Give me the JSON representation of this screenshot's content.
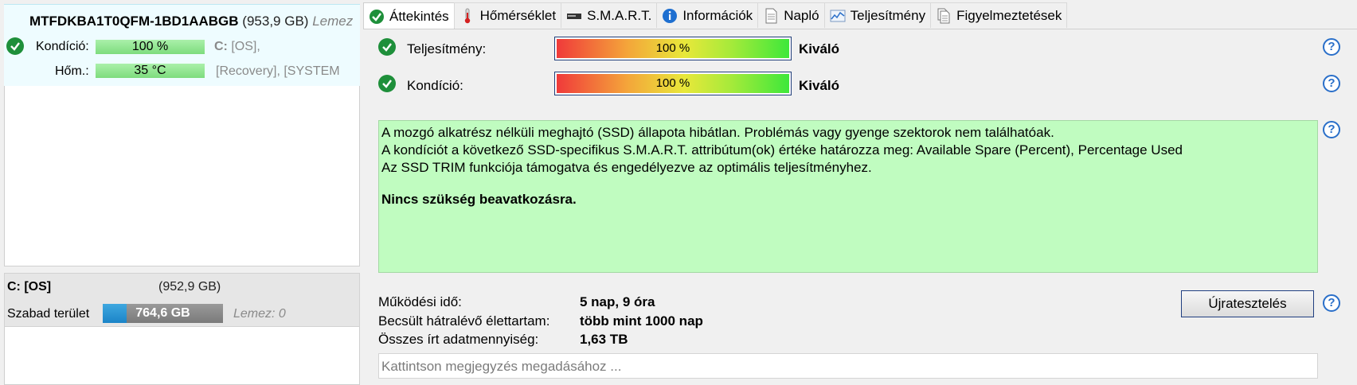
{
  "disk": {
    "model": "MTFDKBA1T0QFM-1BD1AABGB",
    "size": "(953,9 GB)",
    "disk_label": "Lemez",
    "condition_label": "Kondíció:",
    "condition_value": "100 %",
    "temp_label": "Hőm.:",
    "temp_value": "35 °C",
    "volumes_line1": "[OS],",
    "volumes_line1_drive": "C:",
    "volumes_line2": "[Recovery],  [SYSTEM"
  },
  "partition": {
    "title": "C: [OS]",
    "size": "(952,9 GB)",
    "free_label": "Szabad terület",
    "free_value": "764,6 GB",
    "free_fraction": 0.2,
    "disk_index": "Lemez: 0"
  },
  "tabs": [
    {
      "label": "Áttekintés",
      "icon": "check-icon",
      "active": true
    },
    {
      "label": "Hőmérséklet",
      "icon": "thermometer-icon"
    },
    {
      "label": "S.M.A.R.T.",
      "icon": "drive-icon"
    },
    {
      "label": "Információk",
      "icon": "info-icon"
    },
    {
      "label": "Napló",
      "icon": "document-icon"
    },
    {
      "label": "Teljesítmény",
      "icon": "chart-icon"
    },
    {
      "label": "Figyelmeztetések",
      "icon": "alerts-icon"
    }
  ],
  "overview": {
    "performance_label": "Teljesítmény:",
    "performance_value": "100 %",
    "performance_rating": "Kiváló",
    "health_label": "Kondíció:",
    "health_value": "100 %",
    "health_rating": "Kiváló",
    "status_lines": [
      "A mozgó alkatrész nélküli meghajtó (SSD) állapota hibátlan. Problémás vagy gyenge szektorok nem találhatóak.",
      "A kondíciót a következő SSD-specifikus S.M.A.R.T. attribútum(ok) értéke határozza meg:  Available Spare (Percent), Percentage Used",
      "Az SSD TRIM funkciója támogatva és engedélyezve az optimális teljesítményhez."
    ],
    "status_action": "Nincs szükség beavatkozásra.",
    "uptime_label": "Működési idő:",
    "uptime_value": "5 nap, 9 óra",
    "lifetime_label": "Becsült hátralévő élettartam:",
    "lifetime_value": "több mint 1000 nap",
    "written_label": "Összes írt adatmennyiség:",
    "written_value": "1,63 TB",
    "retest_button": "Újratesztelés",
    "note_placeholder": "Kattintson megjegyzés megadásához ..."
  },
  "help_symbol": "?"
}
